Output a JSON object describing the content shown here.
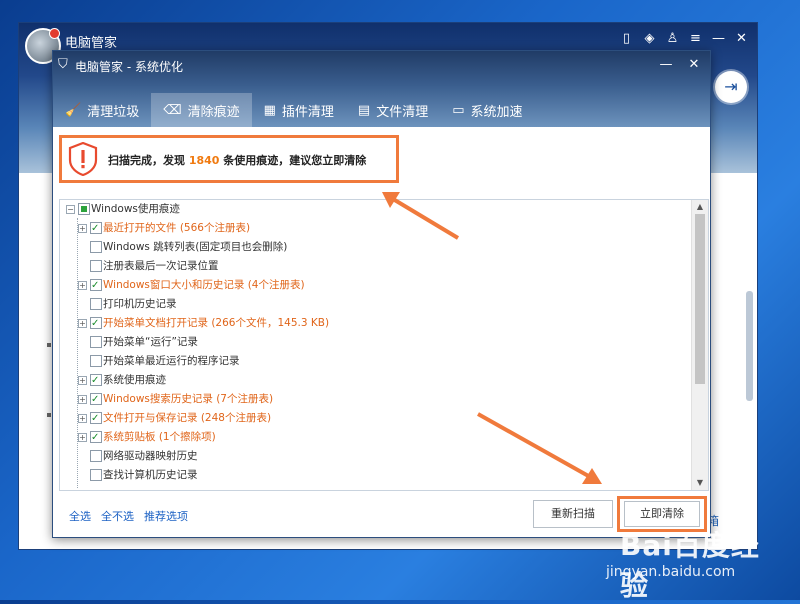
{
  "outer_window": {
    "title": "电脑管家",
    "right_text": "箱"
  },
  "dialog": {
    "title": "电脑管家 - 系统优化",
    "tabs": [
      {
        "label": "清理垃圾",
        "icon": "broom-icon"
      },
      {
        "label": "清除痕迹",
        "icon": "eraser-icon",
        "active": true
      },
      {
        "label": "插件清理",
        "icon": "plugin-icon"
      },
      {
        "label": "文件清理",
        "icon": "folder-icon"
      },
      {
        "label": "系统加速",
        "icon": "monitor-icon"
      }
    ],
    "summary": {
      "prefix": "扫描完成，发现 ",
      "count": "1840",
      "suffix": " 条使用痕迹，建议您立即清除"
    },
    "tree": {
      "root": "Windows使用痕迹",
      "items": [
        {
          "label": "最近打开的文件 (566个注册表)",
          "checked": true,
          "expandable": true,
          "orange": true
        },
        {
          "label": "Windows 跳转列表(固定项目也会删除)",
          "checked": false,
          "expandable": false,
          "orange": false
        },
        {
          "label": "注册表最后一次记录位置",
          "checked": false,
          "expandable": false,
          "orange": false
        },
        {
          "label": "Windows窗口大小和历史记录 (4个注册表)",
          "checked": true,
          "expandable": true,
          "orange": true
        },
        {
          "label": "打印机历史记录",
          "checked": false,
          "expandable": false,
          "orange": false
        },
        {
          "label": "开始菜单文档打开记录 (266个文件，145.3 KB)",
          "checked": true,
          "expandable": true,
          "orange": true
        },
        {
          "label": "开始菜单“运行”记录",
          "checked": false,
          "expandable": false,
          "orange": false
        },
        {
          "label": "开始菜单最近运行的程序记录",
          "checked": false,
          "expandable": false,
          "orange": false
        },
        {
          "label": "系统使用痕迹",
          "checked": true,
          "expandable": true,
          "orange": false
        },
        {
          "label": "Windows搜索历史记录 (7个注册表)",
          "checked": true,
          "expandable": true,
          "orange": true
        },
        {
          "label": "文件打开与保存记录 (248个注册表)",
          "checked": true,
          "expandable": true,
          "orange": true
        },
        {
          "label": "系统剪贴板 (1个擦除项)",
          "checked": true,
          "expandable": true,
          "orange": true
        },
        {
          "label": "网络驱动器映射历史",
          "checked": false,
          "expandable": false,
          "orange": false
        },
        {
          "label": "查找计算机历史记录",
          "checked": false,
          "expandable": false,
          "orange": false
        }
      ]
    },
    "links": {
      "select_all": "全选",
      "select_none": "全不选",
      "recommended": "推荐选项"
    },
    "buttons": {
      "rescan": "重新扫描",
      "clean_now": "立即清除"
    }
  },
  "watermark": {
    "brand": "Bai百度经验",
    "url": "jingyan.baidu.com"
  }
}
